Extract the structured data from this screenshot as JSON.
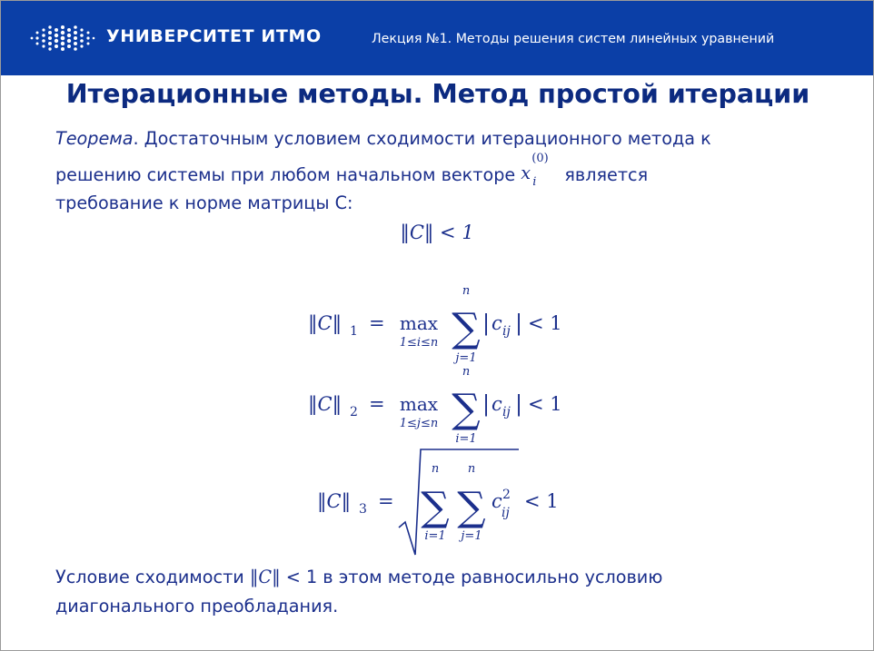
{
  "header": {
    "brand": "УНИВЕРСИТЕТ ИТМО",
    "lecture": "Лекция №1.  Методы решения  систем  линейных  уравнений"
  },
  "title": "Итерационные методы. Метод простой итерации",
  "theorem": {
    "label": "Теорема",
    "line1_rest": ". Достаточным условием сходимости итерационного метода к",
    "line2_a": "решению системы при любом начальном векторе ",
    "var": "x",
    "sup": "(0)",
    "sub": "i",
    "line2_b": " является",
    "line3": "требование к норме матрицы C:"
  },
  "formulas": {
    "main": "‖C‖ < 1",
    "norm1": {
      "lhs_sub": "1",
      "max_cond": "1≤i≤n",
      "sum_top": "n",
      "sum_bottom": "j=1",
      "term_sub": "ij"
    },
    "norm2": {
      "lhs_sub": "2",
      "max_cond": "1≤j≤n",
      "sum_top": "n",
      "sum_bottom": "i=1",
      "term_sub": "ij"
    },
    "norm3": {
      "lhs_sub": "3",
      "sum1_top": "n",
      "sum1_bottom": "i=1",
      "sum2_top": "n",
      "sum2_bottom": "j=1",
      "term_sup": "2",
      "term_sub": "ij"
    },
    "max_word": "max",
    "rhs": "< 1"
  },
  "conclusion": {
    "line1_a": "Условие сходимости ",
    "line1_math": "‖C‖",
    "line1_b": " < 1 в этом методе равносильно условию",
    "line2": "диагонального преобладания."
  },
  "colors": {
    "header_bg": "#0b3fa7",
    "title": "#0c2a80",
    "text": "#1b2f8c"
  }
}
